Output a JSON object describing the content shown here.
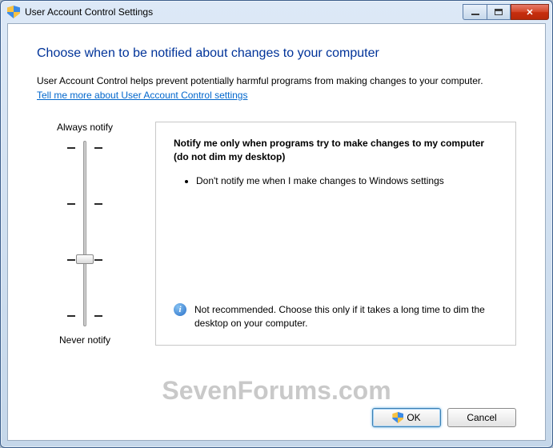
{
  "window": {
    "title": "User Account Control Settings"
  },
  "page": {
    "title": "Choose when to be notified about changes to your computer",
    "intro": "User Account Control helps prevent potentially harmful programs from making changes to your computer.",
    "link": "Tell me more about User Account Control settings"
  },
  "slider": {
    "top_label": "Always notify",
    "bottom_label": "Never notify",
    "level": 1
  },
  "description": {
    "title": "Notify me only when programs try to make changes to my computer (do not dim my desktop)",
    "bullet1": "Don't notify me when I make changes to Windows settings",
    "footer": "Not recommended. Choose this only if it takes a long time to dim the desktop on your computer."
  },
  "buttons": {
    "ok": "OK",
    "cancel": "Cancel"
  },
  "watermark": "SevenForums.com"
}
